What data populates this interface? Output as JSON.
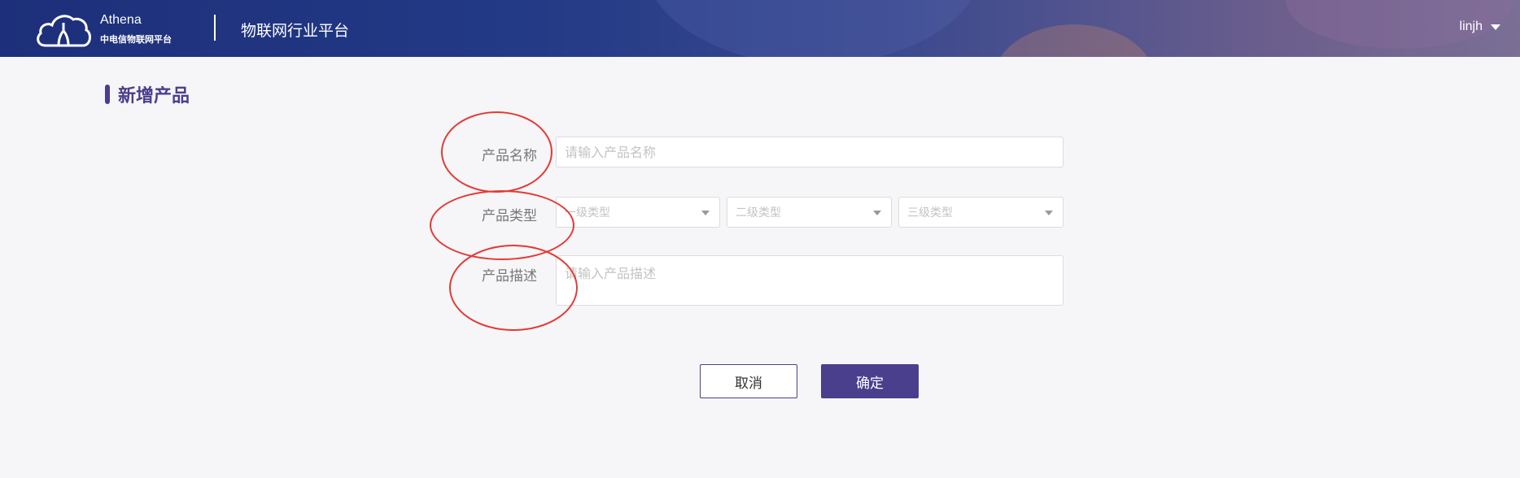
{
  "header": {
    "brand_name": "Athena",
    "brand_subtitle": "中电信物联网平台",
    "platform_title": "物联网行业平台",
    "username": "linjh",
    "logo_icon": "cloud-logo-icon",
    "user_menu_icon": "caret-down-icon"
  },
  "page": {
    "title": "新增产品"
  },
  "form": {
    "name_label": "产品名称",
    "name_placeholder": "请输入产品名称",
    "type_label": "产品类型",
    "type_level1_value": "一级类型",
    "type_level2_value": "二级类型",
    "type_level3_value": "三级类型",
    "desc_label": "产品描述",
    "desc_placeholder": "请输入产品描述"
  },
  "actions": {
    "cancel_label": "取消",
    "confirm_label": "确定"
  },
  "colors": {
    "accent": "#4a3f8c",
    "annotation": "#e53935",
    "header_start": "#1d2f7a"
  }
}
